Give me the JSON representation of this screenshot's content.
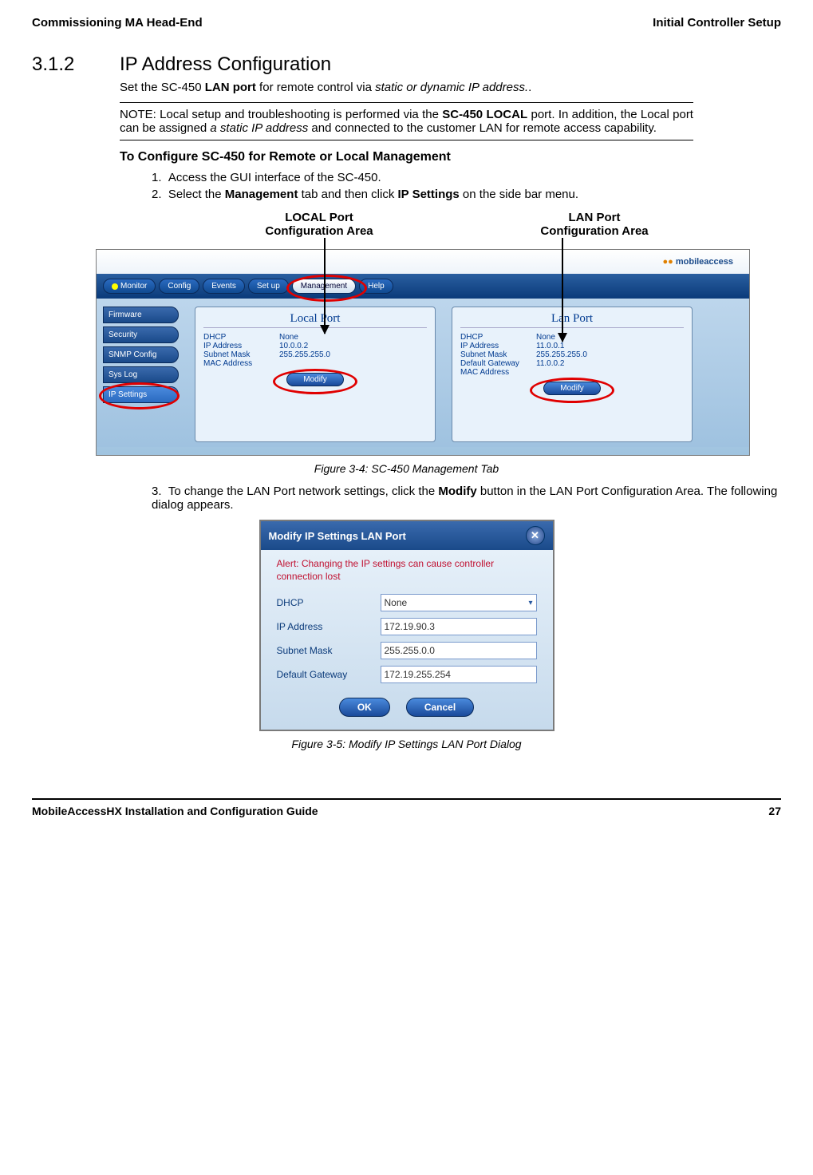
{
  "header": {
    "left": "Commissioning MA Head-End",
    "right": "Initial Controller Setup"
  },
  "section": {
    "number": "3.1.2",
    "title": "IP Address Configuration"
  },
  "intro_pre": "Set the SC-450 ",
  "intro_bold": "LAN port",
  "intro_mid": " for remote control via ",
  "intro_italic": "static or dynamic IP address.",
  "intro_end": ".",
  "note_pre": "NOTE: Local setup and troubleshooting is performed via the ",
  "note_bold1": "SC-450 LOCAL",
  "note_mid": " port. In addition, the Local port can be assigned ",
  "note_italic": "a static IP address",
  "note_end": " and connected to the customer LAN for remote access capability.",
  "subheading": "To Configure SC-450 for Remote or Local Management",
  "step1_num": "1.",
  "step1": "Access the GUI interface of the SC-450.",
  "step2_num": "2.",
  "step2_pre": "Select the ",
  "step2_bold1": "Management",
  "step2_mid": " tab and then click ",
  "step2_bold2": "IP Settings",
  "step2_end": " on the side bar menu.",
  "label_local": "LOCAL Port\nConfiguration Area",
  "label_lan": "LAN Port\nConfiguration Area",
  "shot1": {
    "logo": "mobileaccess",
    "tabs": [
      "Monitor",
      "Config",
      "Events",
      "Set up",
      "Management",
      "Help"
    ],
    "side": [
      "Firmware",
      "Security",
      "SNMP Config",
      "Sys Log",
      "IP Settings"
    ],
    "local": {
      "title": "Local Port",
      "rows": [
        {
          "k": "DHCP",
          "v": "None"
        },
        {
          "k": "IP Address",
          "v": "10.0.0.2"
        },
        {
          "k": "Subnet Mask",
          "v": "255.255.255.0"
        },
        {
          "k": "MAC Address",
          "v": ""
        }
      ],
      "modify": "Modify"
    },
    "lan": {
      "title": "Lan Port",
      "rows": [
        {
          "k": "DHCP",
          "v": "None"
        },
        {
          "k": "IP Address",
          "v": "11.0.0.1"
        },
        {
          "k": "Subnet Mask",
          "v": "255.255.255.0"
        },
        {
          "k": "Default Gateway",
          "v": "11.0.0.2"
        },
        {
          "k": "MAC Address",
          "v": ""
        }
      ],
      "modify": "Modify"
    }
  },
  "fig1": "Figure 3-4: SC-450 Management Tab",
  "step3_num": "3.",
  "step3_pre": "To change the LAN Port network settings, click the ",
  "step3_bold": "Modify",
  "step3_end": " button in the LAN Port Configuration Area. The following dialog appears.",
  "dialog": {
    "title": "Modify IP Settings LAN Port",
    "alert": "Alert: Changing the IP settings can cause controller connection lost",
    "rows": [
      {
        "lbl": "DHCP",
        "val": "None",
        "type": "select"
      },
      {
        "lbl": "IP Address",
        "val": "172.19.90.3",
        "type": "text"
      },
      {
        "lbl": "Subnet Mask",
        "val": "255.255.0.0",
        "type": "text"
      },
      {
        "lbl": "Default Gateway",
        "val": "172.19.255.254",
        "type": "text"
      }
    ],
    "ok": "OK",
    "cancel": "Cancel"
  },
  "fig2": "Figure 3-5: Modify IP Settings LAN Port Dialog",
  "footer": {
    "left": "MobileAccessHX Installation and Configuration Guide",
    "right": "27"
  }
}
